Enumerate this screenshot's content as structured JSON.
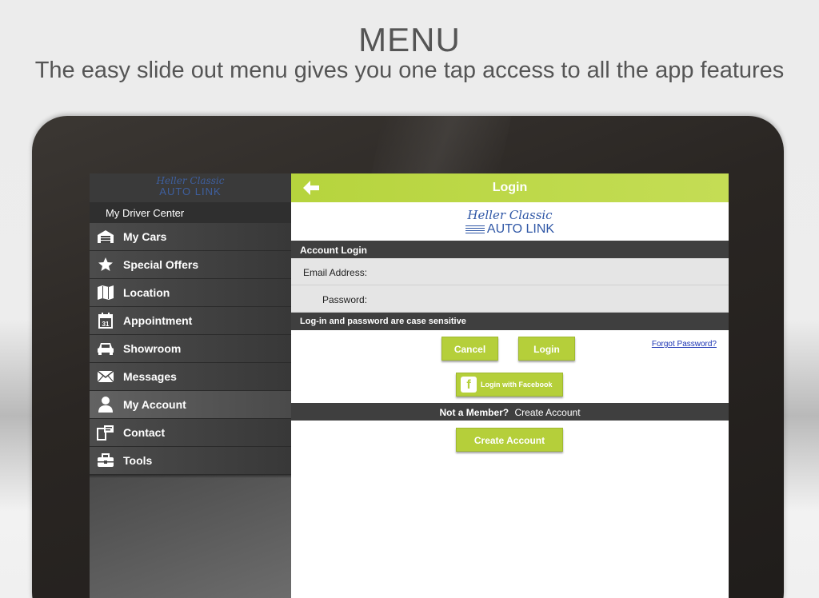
{
  "promo": {
    "headline": "MENU",
    "subline": "The easy slide out menu gives you one tap access to all the app features"
  },
  "sidebar": {
    "logo_script": "Heller Classic",
    "logo_main": "AUTO LINK",
    "header": "My Driver Center",
    "items": [
      {
        "label": "My Cars",
        "icon": "garage-icon"
      },
      {
        "label": "Special Offers",
        "icon": "star-icon"
      },
      {
        "label": "Location",
        "icon": "map-icon"
      },
      {
        "label": "Appointment",
        "icon": "calendar-icon"
      },
      {
        "label": "Showroom",
        "icon": "car-icon"
      },
      {
        "label": "Messages",
        "icon": "envelope-icon"
      },
      {
        "label": "My Account",
        "icon": "person-icon"
      },
      {
        "label": "Contact",
        "icon": "contact-icon"
      },
      {
        "label": "Tools",
        "icon": "toolbox-icon"
      }
    ],
    "calendar_day": "31"
  },
  "main": {
    "title": "Login",
    "brand_script": "Heller Classic",
    "brand_main": "AUTO LINK",
    "section_title": "Account Login",
    "email_label": "Email Address:",
    "email_value": "",
    "password_label": "Password:",
    "password_value": "",
    "note": "Log-in and password are case sensitive",
    "cancel_label": "Cancel",
    "login_label": "Login",
    "forgot_label": "Forgot Password?",
    "facebook_label": "Login with Facebook",
    "facebook_glyph": "f",
    "member_prompt": "Not a Member?",
    "member_link": "Create Account",
    "create_label": "Create Account"
  },
  "colors": {
    "accent_green": "#b5cf3a",
    "brand_blue": "#2f57a6",
    "menu_dark": "#3f3f3f"
  }
}
